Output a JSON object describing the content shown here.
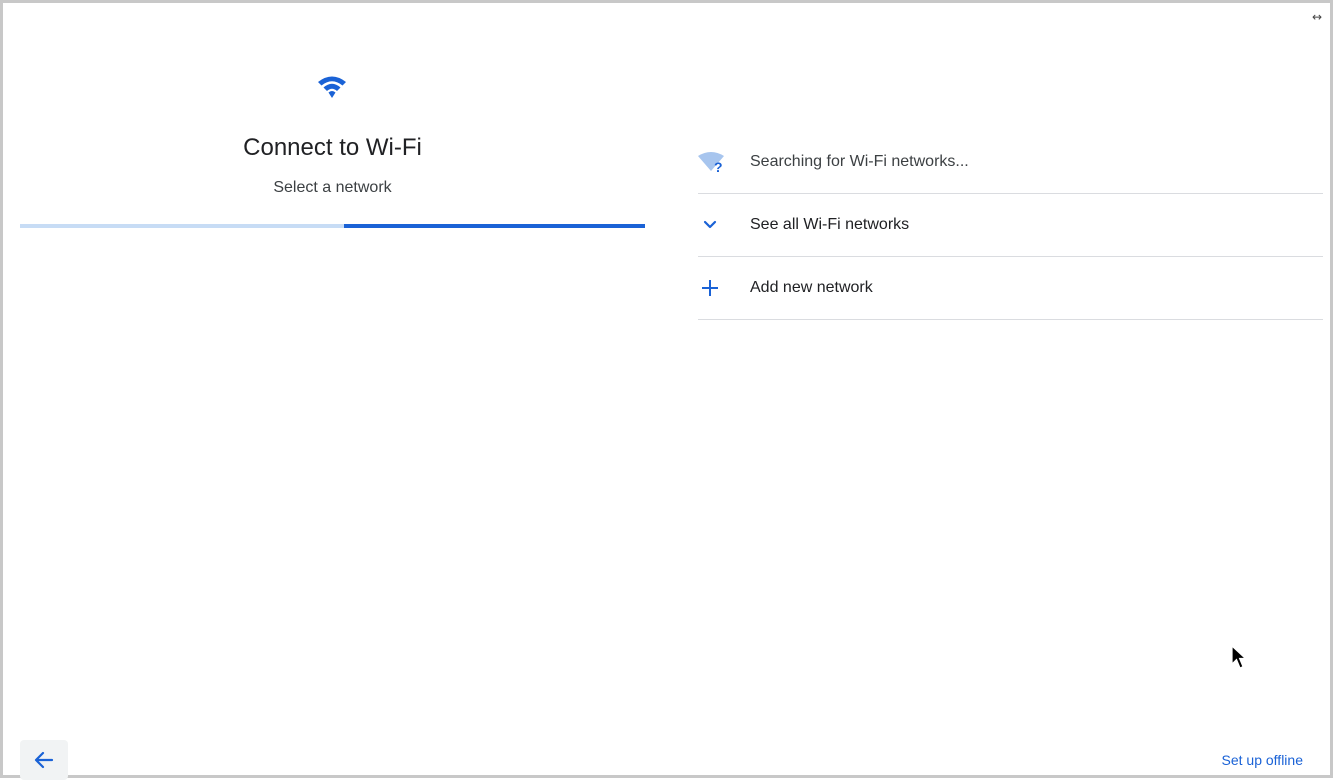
{
  "header": {
    "title": "Connect to Wi-Fi",
    "subtitle": "Select a network",
    "icon": "wifi-icon"
  },
  "progress": {
    "completed_fraction": 0.52
  },
  "networks": {
    "rows": [
      {
        "label": "Searching for Wi-Fi networks...",
        "icon": "wifi-searching-icon"
      },
      {
        "label": "See all Wi-Fi networks",
        "icon": "chevron-down-icon"
      },
      {
        "label": "Add new network",
        "icon": "plus-icon"
      }
    ]
  },
  "footer": {
    "offline_label": "Set up offline",
    "back_icon": "arrow-left-icon"
  },
  "colors": {
    "accent": "#1a62d6",
    "progress_track": "#c7dcf5",
    "divider": "#dadce0",
    "back_button_bg": "#f1f3f4"
  },
  "window": {
    "resize_glyph": "↔"
  }
}
